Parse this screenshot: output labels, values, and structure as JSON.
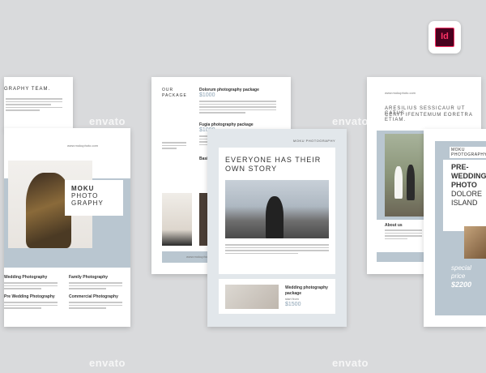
{
  "badge": {
    "label": "Id",
    "icon": "indesign-icon"
  },
  "watermark": "envato",
  "page1": {
    "header": "GRAPHY TEAM.",
    "website": "www.mokuphoto.com",
    "title_lines": [
      "MOKU",
      "PHOTO",
      "GRAPHY"
    ],
    "services": [
      "Wedding Photography",
      "Family Photography",
      "Pre Wedding Photography",
      "Commercial Photography"
    ]
  },
  "page2": {
    "section_title": [
      "OUR",
      "PACKAGE"
    ],
    "packages": [
      {
        "name": "Dolorum photography package",
        "price": "$1000"
      },
      {
        "name": "Fugia photography package",
        "price": "$1000"
      },
      {
        "name": "Basic",
        "price": ""
      }
    ],
    "website": "www.mokuphoto.com"
  },
  "page3": {
    "header": "MOKU PHOTOGRAPHY",
    "headline": [
      "EVERYONE HAS THEIR",
      "OWN STORY"
    ],
    "card": {
      "title": [
        "Wedding photography",
        "package"
      ],
      "start": "start from",
      "price": "$1500"
    }
  },
  "page4": {
    "website": "www.mokuphoto.com",
    "quote": [
      "ARESILIUS SESSICAUR UT CATUS",
      "CERIT IFENTEMUM EORETRA ETIAM."
    ],
    "about": "About us"
  },
  "page5": {
    "header": "MOKU PHOTOGRAPHY",
    "headline": [
      "PRE-",
      "WEDDING",
      "PHOTO",
      "DOLORE",
      "ISLAND"
    ],
    "special": [
      "special",
      "price"
    ],
    "price": "$2200"
  }
}
